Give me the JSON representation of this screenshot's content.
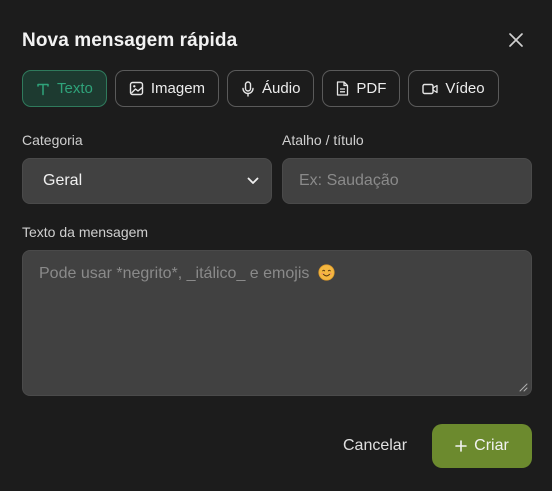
{
  "dialog": {
    "title": "Nova mensagem rápida"
  },
  "tabs": [
    {
      "label": "Texto",
      "icon": "text-icon",
      "active": true
    },
    {
      "label": "Imagem",
      "icon": "image-icon",
      "active": false
    },
    {
      "label": "Áudio",
      "icon": "microphone-icon",
      "active": false
    },
    {
      "label": "PDF",
      "icon": "document-icon",
      "active": false
    },
    {
      "label": "Vídeo",
      "icon": "video-icon",
      "active": false
    }
  ],
  "form": {
    "category_label": "Categoria",
    "category_value": "Geral",
    "shortcut_label": "Atalho / título",
    "shortcut_placeholder": "Ex: Saudação",
    "message_label": "Texto da mensagem",
    "message_placeholder": "Pode usar *negrito*, _itálico_ e emojis"
  },
  "actions": {
    "cancel_label": "Cancelar",
    "create_label": "Criar"
  },
  "colors": {
    "active_tab": "#2fa37a",
    "create_button": "#6c8a2e",
    "field_bg": "#414141"
  }
}
